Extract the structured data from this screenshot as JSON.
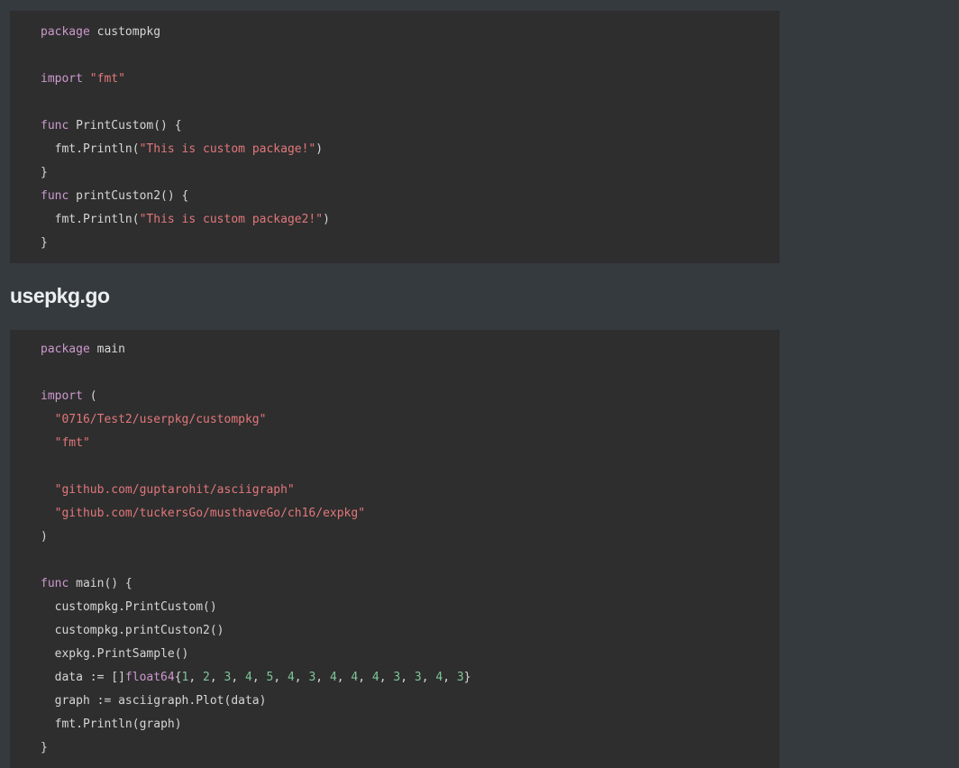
{
  "colors": {
    "page_background": "#353a3f",
    "code_background": "#2e2e2e",
    "plain": "#d6d6d6",
    "keyword": "#cc99cd",
    "string": "#f08d49",
    "string_soft": "#e2777a",
    "number": "#7ec699",
    "type": "#cc99cd",
    "property": "#9fb8a8"
  },
  "code_block_1": {
    "lines": [
      [
        {
          "t": "package",
          "k": "keyword"
        },
        {
          "t": " custompkg",
          "k": "plain"
        }
      ],
      [],
      [
        {
          "t": "import",
          "k": "keyword"
        },
        {
          "t": " ",
          "k": "plain"
        },
        {
          "t": "\"fmt\"",
          "k": "string_soft"
        }
      ],
      [],
      [
        {
          "t": "func",
          "k": "keyword"
        },
        {
          "t": " PrintCustom() {",
          "k": "plain"
        }
      ],
      [
        {
          "t": "  fmt.",
          "k": "plain"
        },
        {
          "t": "Println",
          "k": "plain"
        },
        {
          "t": "(",
          "k": "plain"
        },
        {
          "t": "\"This is custom package!\"",
          "k": "string_soft"
        },
        {
          "t": ")",
          "k": "plain"
        }
      ],
      [
        {
          "t": "}",
          "k": "plain"
        }
      ],
      [
        {
          "t": "func",
          "k": "keyword"
        },
        {
          "t": " printCuston2() {",
          "k": "plain"
        }
      ],
      [
        {
          "t": "  fmt.",
          "k": "plain"
        },
        {
          "t": "Println",
          "k": "plain"
        },
        {
          "t": "(",
          "k": "plain"
        },
        {
          "t": "\"This is custom package2!\"",
          "k": "string_soft"
        },
        {
          "t": ")",
          "k": "plain"
        }
      ],
      [
        {
          "t": "}",
          "k": "plain"
        }
      ]
    ]
  },
  "heading": {
    "text": "usepkg.go"
  },
  "code_block_2": {
    "lines": [
      [
        {
          "t": "package",
          "k": "keyword"
        },
        {
          "t": " main",
          "k": "plain"
        }
      ],
      [],
      [
        {
          "t": "import",
          "k": "keyword"
        },
        {
          "t": " (",
          "k": "plain"
        }
      ],
      [
        {
          "t": "  ",
          "k": "plain"
        },
        {
          "t": "\"0716/Test2/userpkg/custompkg\"",
          "k": "string_soft"
        }
      ],
      [
        {
          "t": "  ",
          "k": "plain"
        },
        {
          "t": "\"fmt\"",
          "k": "string_soft"
        }
      ],
      [],
      [
        {
          "t": "  ",
          "k": "plain"
        },
        {
          "t": "\"github.com/guptarohit/asciigraph\"",
          "k": "string_soft"
        }
      ],
      [
        {
          "t": "  ",
          "k": "plain"
        },
        {
          "t": "\"github.com/tuckersGo/musthaveGo/ch16/expkg\"",
          "k": "string_soft"
        }
      ],
      [
        {
          "t": ")",
          "k": "plain"
        }
      ],
      [],
      [
        {
          "t": "func",
          "k": "keyword"
        },
        {
          "t": " main() {",
          "k": "plain"
        }
      ],
      [
        {
          "t": "  custompkg.",
          "k": "plain"
        },
        {
          "t": "PrintCustom",
          "k": "plain"
        },
        {
          "t": "()",
          "k": "plain"
        }
      ],
      [
        {
          "t": "  custompkg.",
          "k": "plain"
        },
        {
          "t": "printCuston2",
          "k": "plain"
        },
        {
          "t": "()",
          "k": "plain"
        }
      ],
      [
        {
          "t": "  expkg.",
          "k": "plain"
        },
        {
          "t": "PrintSample",
          "k": "plain"
        },
        {
          "t": "()",
          "k": "plain"
        }
      ],
      [
        {
          "t": "  data := []",
          "k": "plain"
        },
        {
          "t": "float64",
          "k": "type"
        },
        {
          "t": "{",
          "k": "plain"
        },
        {
          "t": "1",
          "k": "number"
        },
        {
          "t": ", ",
          "k": "plain"
        },
        {
          "t": "2",
          "k": "number"
        },
        {
          "t": ", ",
          "k": "plain"
        },
        {
          "t": "3",
          "k": "number"
        },
        {
          "t": ", ",
          "k": "plain"
        },
        {
          "t": "4",
          "k": "number"
        },
        {
          "t": ", ",
          "k": "plain"
        },
        {
          "t": "5",
          "k": "number"
        },
        {
          "t": ", ",
          "k": "plain"
        },
        {
          "t": "4",
          "k": "number"
        },
        {
          "t": ", ",
          "k": "plain"
        },
        {
          "t": "3",
          "k": "number"
        },
        {
          "t": ", ",
          "k": "plain"
        },
        {
          "t": "4",
          "k": "number"
        },
        {
          "t": ", ",
          "k": "plain"
        },
        {
          "t": "4",
          "k": "number"
        },
        {
          "t": ", ",
          "k": "plain"
        },
        {
          "t": "4",
          "k": "number"
        },
        {
          "t": ", ",
          "k": "plain"
        },
        {
          "t": "3",
          "k": "number"
        },
        {
          "t": ", ",
          "k": "plain"
        },
        {
          "t": "3",
          "k": "number"
        },
        {
          "t": ", ",
          "k": "plain"
        },
        {
          "t": "4",
          "k": "number"
        },
        {
          "t": ", ",
          "k": "plain"
        },
        {
          "t": "3",
          "k": "number"
        },
        {
          "t": "}",
          "k": "plain"
        }
      ],
      [
        {
          "t": "  graph := asciigraph.",
          "k": "plain"
        },
        {
          "t": "Plot",
          "k": "plain"
        },
        {
          "t": "(data)",
          "k": "plain"
        }
      ],
      [
        {
          "t": "  fmt.",
          "k": "plain"
        },
        {
          "t": "Println",
          "k": "plain"
        },
        {
          "t": "(graph)",
          "k": "plain"
        }
      ],
      [
        {
          "t": "}",
          "k": "plain"
        }
      ]
    ]
  }
}
